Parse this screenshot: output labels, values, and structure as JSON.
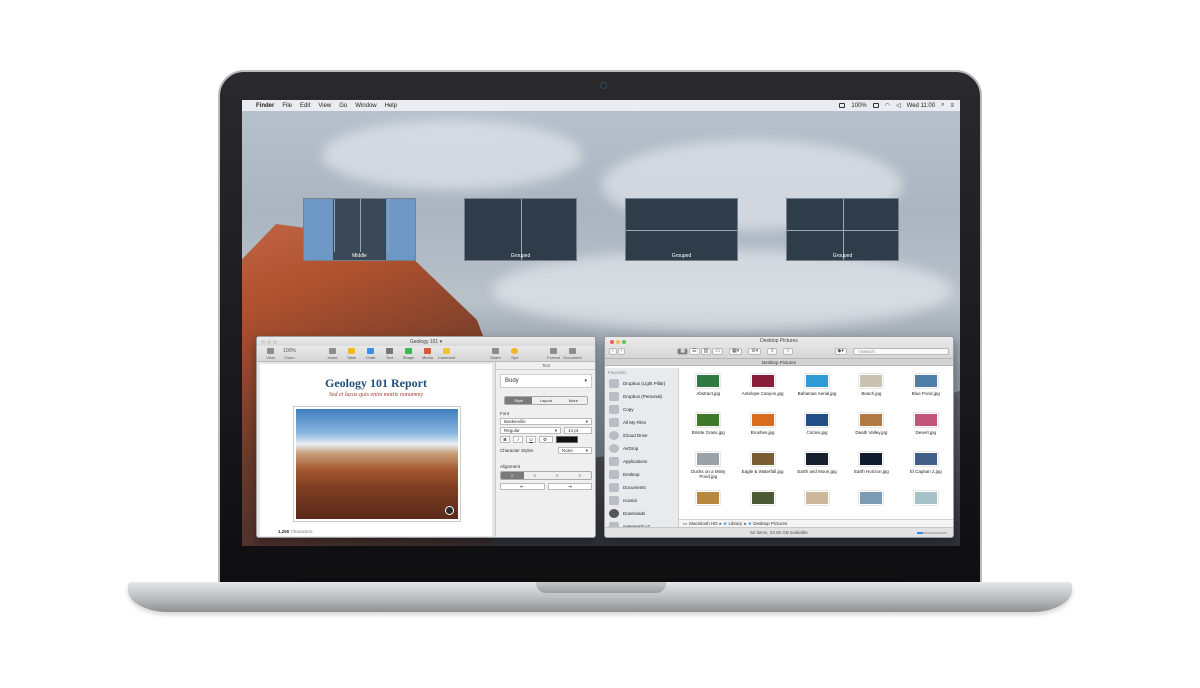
{
  "menubar": {
    "apple": "",
    "app": "Finder",
    "menus": [
      "File",
      "Edit",
      "View",
      "Go",
      "Window",
      "Help"
    ],
    "battery": "100%",
    "clock": "Wed 11:00"
  },
  "spaces": [
    {
      "label": "Middle"
    },
    {
      "label": "Grouped"
    },
    {
      "label": "Grouped"
    },
    {
      "label": "Grouped"
    }
  ],
  "pages": {
    "window_title": "Geology 101 ▾",
    "toolbar": [
      "View",
      "Zoom",
      "Insert",
      "Table",
      "Chart",
      "Text",
      "Shape",
      "Media",
      "Comment",
      "Share",
      "Tips",
      "Format",
      "Document"
    ],
    "zoom_value": "100%",
    "doc_title": "Geology 101 Report",
    "doc_subtitle": "Sed et lacus quis enim mattis nonummy",
    "word_count": "1,260",
    "word_count_label": "Characters",
    "inspector": {
      "header": "Text",
      "paragraph_style": "Body",
      "tabs": [
        "Style",
        "Layout",
        "More"
      ],
      "font_label": "Font",
      "font_family": "Baskerville",
      "font_weight": "Regular",
      "font_size": "14 pt",
      "b": "B",
      "i": "I",
      "u": "U",
      "char_styles_label": "Character Styles",
      "char_styles_value": "None",
      "alignment_label": "Alignment"
    }
  },
  "finder": {
    "window_title": "Desktop Pictures",
    "path_tab": "Desktop Pictures",
    "search_placeholder": "Search",
    "sidebar_header": "Favorites",
    "sidebar": [
      "Dropbox (Light Pillar)",
      "Dropbox (Personal)",
      "Copy",
      "All My Files",
      "iCloud Drive",
      "AirDrop",
      "Applications",
      "Desktop",
      "Documents",
      "ncosini",
      "Downloads",
      "nyteneanh v2"
    ],
    "files": [
      {
        "name": "Abstract.jpg",
        "color": "#2f7a3f"
      },
      {
        "name": "Antelope Canyon.jpg",
        "color": "#8a1e3a"
      },
      {
        "name": "Bahamas Aerial.jpg",
        "color": "#2e9bd6"
      },
      {
        "name": "Beach.jpg",
        "color": "#c9c2b0"
      },
      {
        "name": "Blue Pond.jpg",
        "color": "#4d7ea8"
      },
      {
        "name": "Bristle Grass.jpg",
        "color": "#3f7a2a"
      },
      {
        "name": "Brushes.jpg",
        "color": "#d96b1e"
      },
      {
        "name": "Circles.jpg",
        "color": "#1f4f86"
      },
      {
        "name": "Death Valley.jpg",
        "color": "#b07a45"
      },
      {
        "name": "Desert.jpg",
        "color": "#c2567a"
      },
      {
        "name": "Ducks on a Misty Pond.jpg",
        "color": "#9aa1a8"
      },
      {
        "name": "Eagle & Waterfall.jpg",
        "color": "#7a5d35"
      },
      {
        "name": "Earth and Moon.jpg",
        "color": "#16202e"
      },
      {
        "name": "Earth Horizon.jpg",
        "color": "#0e1a2d"
      },
      {
        "name": "El Capitan 2.jpg",
        "color": "#3f5f86"
      },
      {
        "name": "",
        "color": "#b88740"
      },
      {
        "name": "",
        "color": "#4e5a35"
      },
      {
        "name": "",
        "color": "#cdb79a"
      },
      {
        "name": "",
        "color": "#7d9bb5"
      },
      {
        "name": "",
        "color": "#a6c2c8"
      }
    ],
    "breadcrumbs": [
      "Macintosh HD",
      "Library",
      "Desktop Pictures"
    ],
    "status": "52 items, 23.06 GB available"
  }
}
